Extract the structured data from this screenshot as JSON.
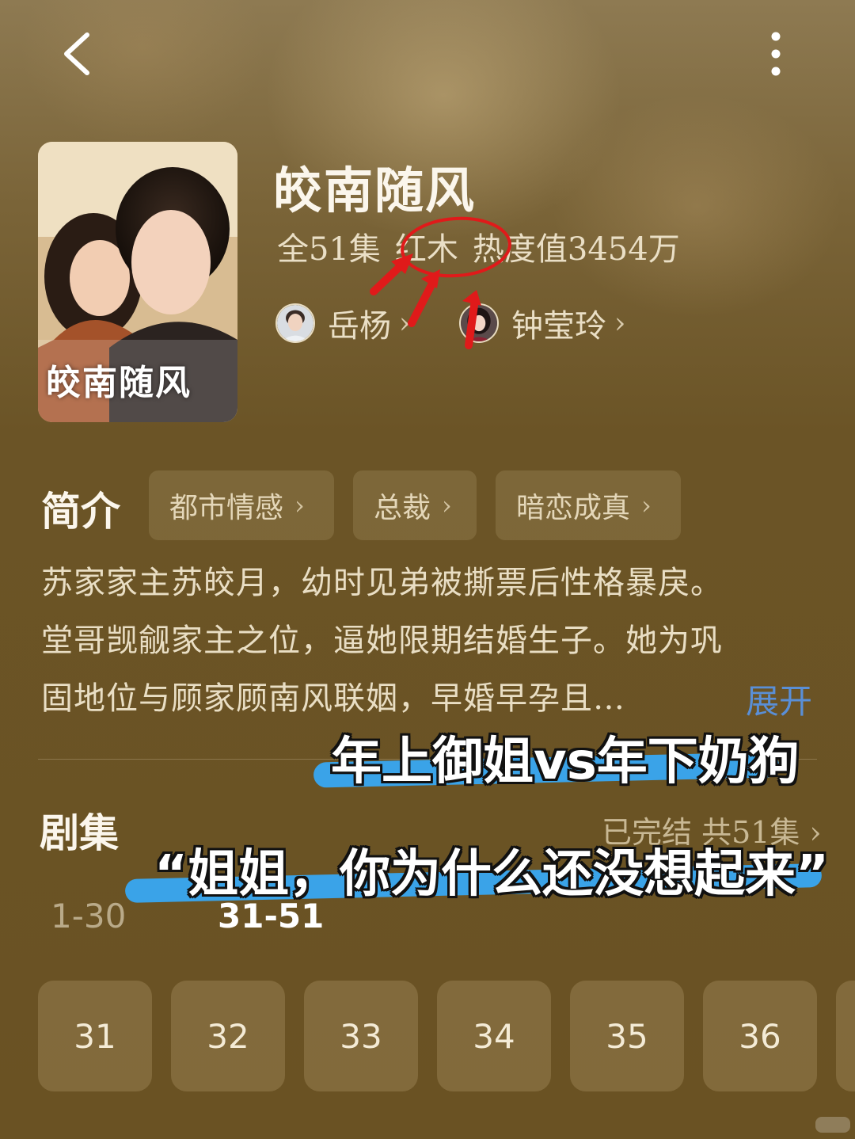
{
  "header": {
    "back_icon": "chevron-left-icon",
    "more_icon": "more-vertical-icon"
  },
  "drama": {
    "cover_title": "皎南随风",
    "title": "皎南随风",
    "episodes_count": "全51集",
    "tag_red": "红木",
    "popularity": "热度值3454万"
  },
  "cast": [
    {
      "name": "岳杨",
      "chevron": "›"
    },
    {
      "name": "钟莹玲",
      "chevron": "›"
    }
  ],
  "intro": {
    "label": "简介",
    "tags": [
      {
        "label": "都市情感",
        "chevron": "›"
      },
      {
        "label": "总裁",
        "chevron": "›"
      },
      {
        "label": "暗恋成真",
        "chevron": "›"
      }
    ],
    "synopsis_lines": [
      "苏家家主苏皎月，幼时见弟被撕票后性格暴戾。",
      "堂哥觊觎家主之位，逼她限期结婚生子。她为巩",
      "固地位与顾家顾南风联姻，早婚早孕且…"
    ],
    "expand_label": "展开"
  },
  "overlay_captions": {
    "caption_1": "年上御姐vs年下奶狗",
    "caption_2": "“姐姐，你为什么还没想起来”"
  },
  "episodes": {
    "label": "剧集",
    "status": "已完结 共51集 ›",
    "ranges": [
      "1-30",
      "31-51"
    ],
    "selected_range": "31-51",
    "items": [
      "31",
      "32",
      "33",
      "34",
      "35",
      "36"
    ]
  },
  "colors": {
    "accent_blue": "#5a8fd6",
    "annotation_red": "#e01a1a",
    "highlight_blue": "#3aa3e8"
  }
}
